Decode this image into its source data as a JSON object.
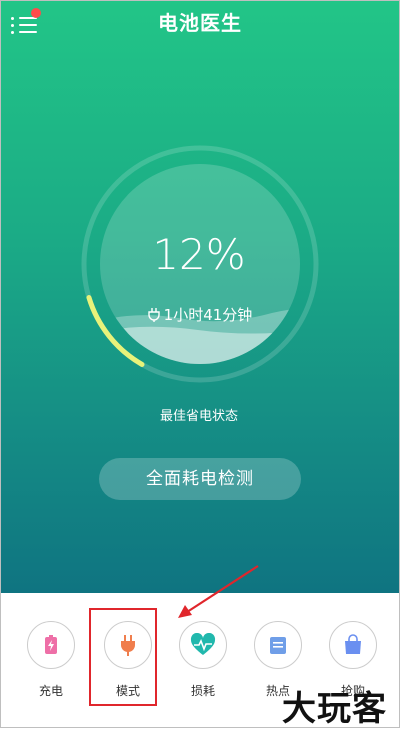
{
  "app": {
    "title": "电池医生"
  },
  "battery": {
    "percent": "12%",
    "level": 0.12,
    "remaining": "1小时41分钟",
    "status": "最佳省电状态"
  },
  "actions": {
    "detect_label": "全面耗电检测"
  },
  "nav": [
    {
      "label": "充电",
      "icon": "battery-charge-icon",
      "color": "#ee6fa7"
    },
    {
      "label": "模式",
      "icon": "plug-icon",
      "color": "#f07e4d"
    },
    {
      "label": "损耗",
      "icon": "heart-pulse-icon",
      "color": "#21b8ad"
    },
    {
      "label": "热点",
      "icon": "notes-icon",
      "color": "#6f9ee8"
    },
    {
      "label": "抢购",
      "icon": "shopping-bag-icon",
      "color": "#6a8ff0"
    }
  ],
  "watermark": "大玩客",
  "colors": {
    "gradient_top": "#22c587",
    "gradient_bottom": "#0f7481",
    "gauge_arc": "#e8f27a",
    "highlight": "#e0262c",
    "badge": "#ff4b4b"
  }
}
